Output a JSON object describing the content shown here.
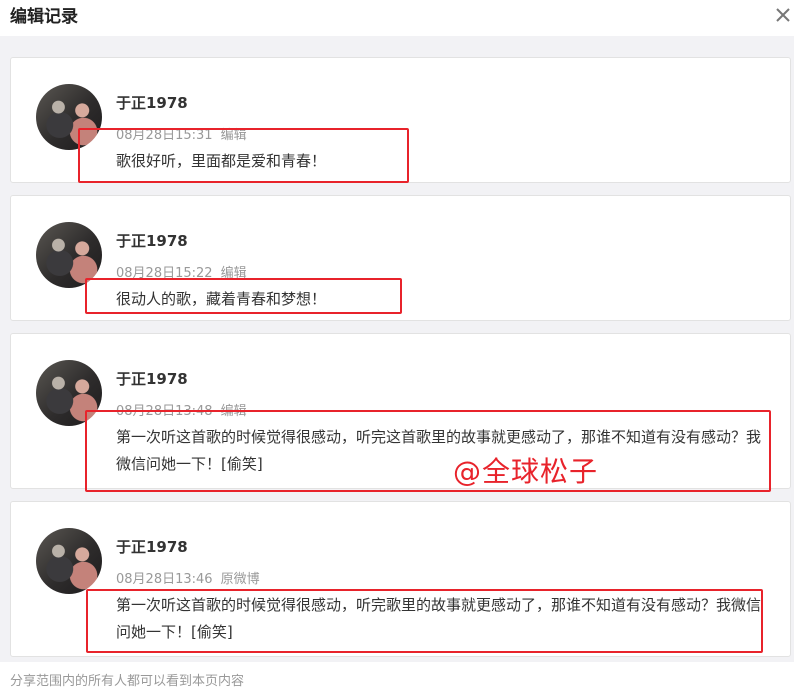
{
  "dialog": {
    "title": "编辑记录",
    "close_icon": "close-icon"
  },
  "records": [
    {
      "author": "于正1978",
      "time": "08月28日15:31",
      "action": "编辑",
      "text": "歌很好听，里面都是爱和青春！"
    },
    {
      "author": "于正1978",
      "time": "08月28日15:22",
      "action": "编辑",
      "text": "很动人的歌，藏着青春和梦想！"
    },
    {
      "author": "于正1978",
      "time": "08月28日13:48",
      "action": "编辑",
      "text": "第一次听这首歌的时候觉得很感动，听完这首歌里的故事就更感动了，那谁不知道有没有感动？我微信问她一下！[偷笑]"
    },
    {
      "author": "于正1978",
      "time": "08月28日13:46",
      "action": "原微博",
      "text": "第一次听这首歌的时候觉得很感动，听完歌里的故事就更感动了，那谁不知道有没有感动？我微信问她一下！[偷笑]"
    }
  ],
  "watermark": "@全球松子",
  "footer": "分享范围内的所有人都可以看到本页内容",
  "colors": {
    "highlight": "#e8232b",
    "background": "#f2f2f5"
  }
}
